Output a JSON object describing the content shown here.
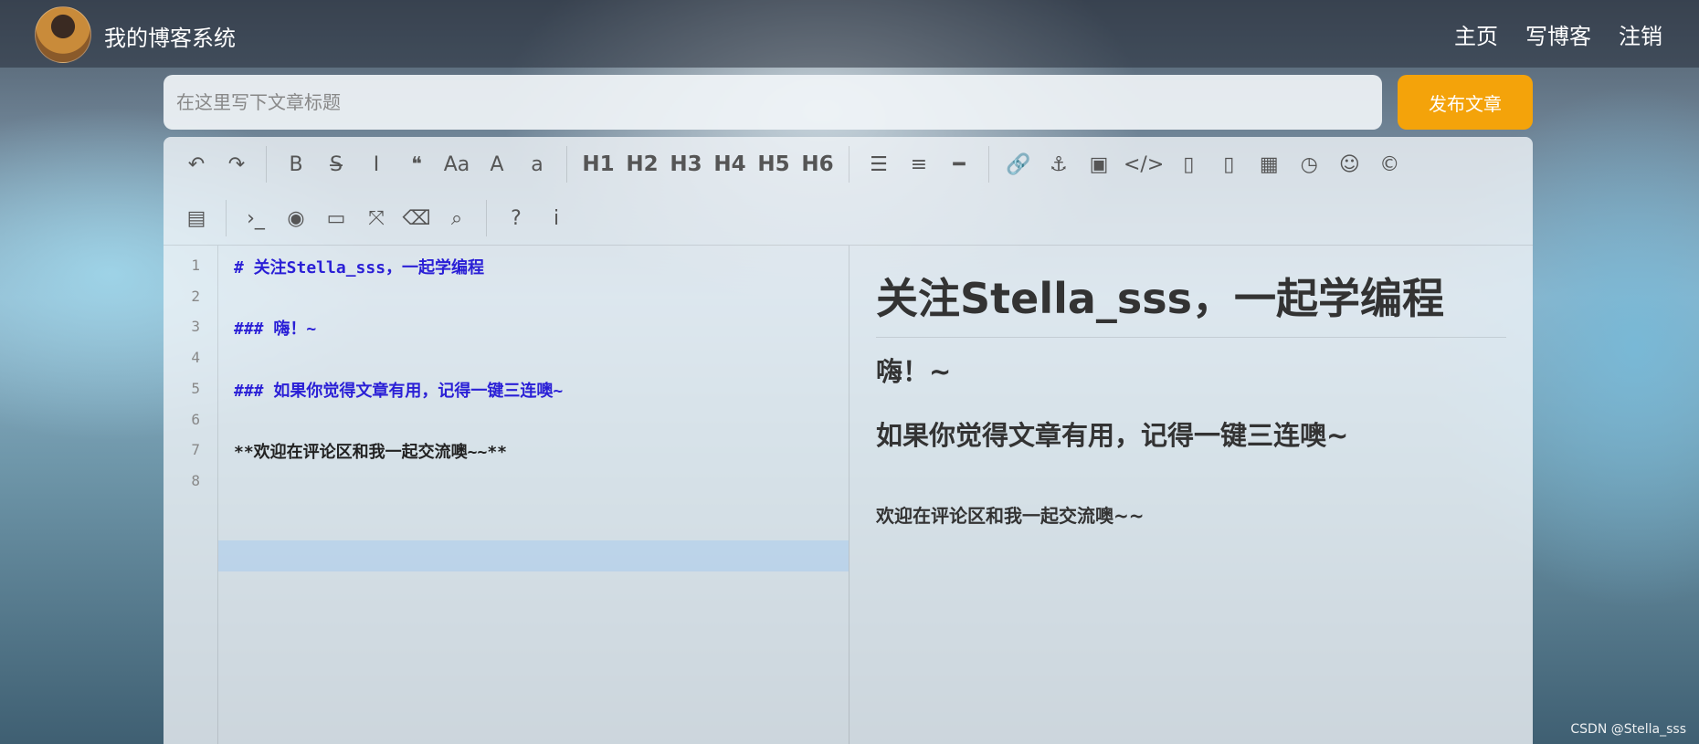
{
  "navbar": {
    "site_title": "我的博客系统",
    "links": [
      "主页",
      "写博客",
      "注销"
    ]
  },
  "editor_form": {
    "title_placeholder": "在这里写下文章标题",
    "publish_label": "发布文章"
  },
  "toolbar": {
    "row1": [
      {
        "icon": "undo-icon",
        "glyph": "↶"
      },
      {
        "icon": "redo-icon",
        "glyph": "↷"
      },
      {
        "sep": true
      },
      {
        "icon": "bold-icon",
        "glyph": "B"
      },
      {
        "icon": "strikethrough-icon",
        "glyph": "S̶"
      },
      {
        "icon": "italic-icon",
        "glyph": "I"
      },
      {
        "icon": "quote-icon",
        "glyph": "❝"
      },
      {
        "icon": "uppercase-icon",
        "glyph": "Aa"
      },
      {
        "icon": "capitalize-icon",
        "glyph": "A"
      },
      {
        "icon": "lowercase-icon",
        "glyph": "a"
      },
      {
        "sep": true
      },
      {
        "icon": "h1-button",
        "label": "H1",
        "h": true
      },
      {
        "icon": "h2-button",
        "label": "H2",
        "h": true
      },
      {
        "icon": "h3-button",
        "label": "H3",
        "h": true
      },
      {
        "icon": "h4-button",
        "label": "H4",
        "h": true
      },
      {
        "icon": "h5-button",
        "label": "H5",
        "h": true
      },
      {
        "icon": "h6-button",
        "label": "H6",
        "h": true
      },
      {
        "sep": true
      },
      {
        "icon": "unordered-list-icon",
        "glyph": "☰"
      },
      {
        "icon": "ordered-list-icon",
        "glyph": "≡"
      },
      {
        "icon": "horizontal-rule-icon",
        "glyph": "━"
      },
      {
        "sep": true
      },
      {
        "icon": "link-icon",
        "glyph": "🔗"
      },
      {
        "icon": "anchor-icon",
        "glyph": "⚓"
      },
      {
        "icon": "image-icon",
        "glyph": "▣"
      },
      {
        "icon": "code-icon",
        "glyph": "</>"
      },
      {
        "icon": "preformatted-code-icon",
        "glyph": "▯"
      },
      {
        "icon": "code-block-icon",
        "glyph": "▯"
      },
      {
        "icon": "table-icon",
        "glyph": "▦"
      },
      {
        "icon": "datetime-icon",
        "glyph": "◷"
      },
      {
        "icon": "emoji-icon",
        "glyph": "☺"
      },
      {
        "icon": "html-entities-icon",
        "glyph": "©"
      }
    ],
    "row2": [
      {
        "icon": "pagebreak-icon",
        "glyph": "▤"
      },
      {
        "sep": true
      },
      {
        "icon": "goto-line-icon",
        "glyph": "›_"
      },
      {
        "icon": "watch-toggle-icon",
        "glyph": "◉"
      },
      {
        "icon": "preview-icon",
        "glyph": "▭"
      },
      {
        "icon": "fullscreen-icon",
        "glyph": "⤧"
      },
      {
        "icon": "clear-icon",
        "glyph": "⌫"
      },
      {
        "icon": "search-icon",
        "glyph": "⌕"
      },
      {
        "sep": true
      },
      {
        "icon": "help-icon",
        "glyph": "?"
      },
      {
        "icon": "info-icon",
        "glyph": "i"
      }
    ]
  },
  "code_lines": [
    {
      "num": "1",
      "text": "# 关注Stella_sss，一起学编程",
      "kind": "head"
    },
    {
      "num": "2",
      "text": "",
      "kind": "text"
    },
    {
      "num": "3",
      "text": "### 嗨！~",
      "kind": "head"
    },
    {
      "num": "4",
      "text": "",
      "kind": "text"
    },
    {
      "num": "5",
      "text": "### 如果你觉得文章有用，记得一键三连噢~",
      "kind": "head"
    },
    {
      "num": "6",
      "text": "",
      "kind": "text"
    },
    {
      "num": "7",
      "text": "**欢迎在评论区和我一起交流噢~~**",
      "kind": "text"
    },
    {
      "num": "8",
      "text": "",
      "kind": "text"
    }
  ],
  "preview": {
    "h1": "关注Stella_sss，一起学编程",
    "h3_a": "嗨！~",
    "h3_b": "如果你觉得文章有用，记得一键三连噢~",
    "strong": "欢迎在评论区和我一起交流噢~~"
  },
  "watermark": "CSDN @Stella_sss"
}
